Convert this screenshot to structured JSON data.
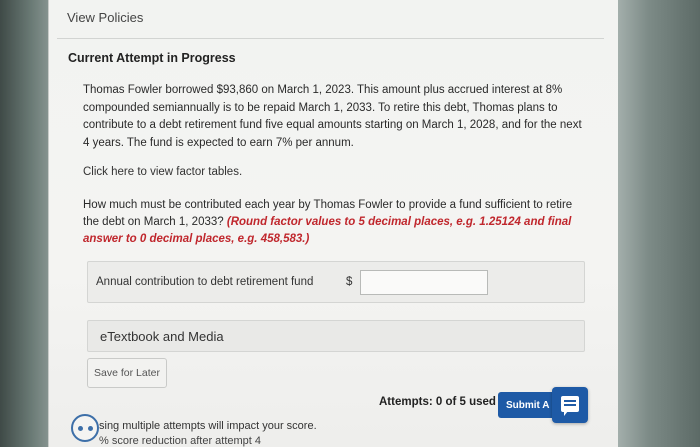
{
  "header": {
    "view_policies": "View Policies",
    "section_title": "Current Attempt in Progress"
  },
  "problem": {
    "text": "Thomas Fowler borrowed $93,860 on March 1, 2023. This amount plus accrued interest at 8% compounded semiannually is to be repaid March 1, 2033. To retire this debt, Thomas plans to contribute to a debt retirement fund five equal amounts starting on March 1, 2028, and for the next 4 years. The fund is expected to earn 7% per annum.",
    "factor_link": "Click here to view factor tables."
  },
  "question": {
    "text": "How much must be contributed each year by Thomas Fowler to provide a fund sufficient to retire the debt on March 1, 2033? ",
    "hint": "(Round factor values to 5 decimal places, e.g. 1.25124 and final answer to 0 decimal places, e.g. 458,583.)"
  },
  "answer": {
    "label": "Annual contribution to debt retirement fund",
    "currency": "$",
    "value": ""
  },
  "etextbook": {
    "label": "eTextbook and Media"
  },
  "actions": {
    "save_later": "Save for Later",
    "attempts": "Attempts: 0 of 5 used",
    "submit": "Submit A"
  },
  "warning": {
    "line1": "sing multiple attempts will impact your score.",
    "line2": "% score reduction after attempt 4"
  },
  "colors": {
    "accent": "#1e5aa6",
    "hint": "#c0272d"
  }
}
